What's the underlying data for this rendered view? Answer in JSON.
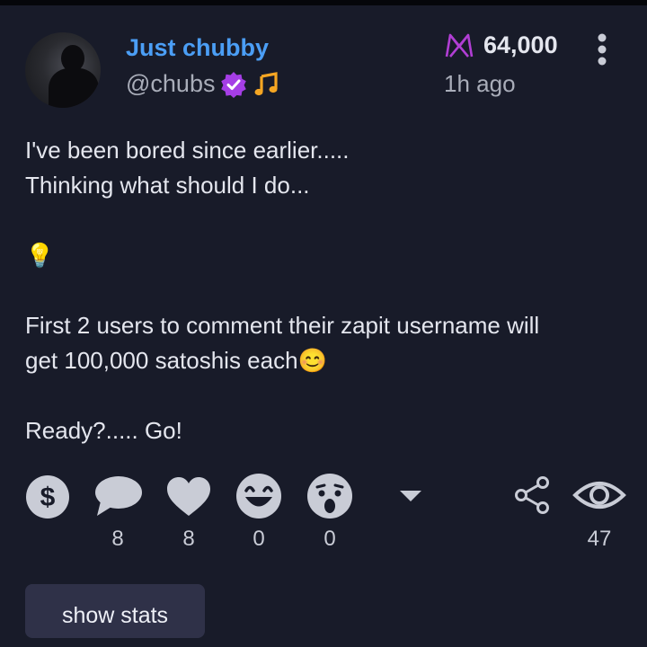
{
  "post": {
    "author_name": "Just chubby",
    "handle": "@chubs",
    "score": "64,000",
    "time": "1h ago",
    "body": {
      "line1": "I've been bored since earlier.....",
      "line2": "Thinking what should I do...",
      "bulb": "💡",
      "line3": "First 2 users to comment their zapit username will",
      "line4": "get 100,000 satoshis each",
      "smile": "😊",
      "line5": "Ready?..... Go!"
    }
  },
  "reactions": {
    "comments": "8",
    "likes": "8",
    "laughs": "0",
    "wows": "0",
    "views": "47"
  },
  "actions": {
    "show_stats": "show stats"
  },
  "colors": {
    "background": "#181b29",
    "name": "#4b9ef5",
    "verified": "#a53ee6",
    "music": "#f5a623",
    "score_icon": "#b13ed4"
  }
}
